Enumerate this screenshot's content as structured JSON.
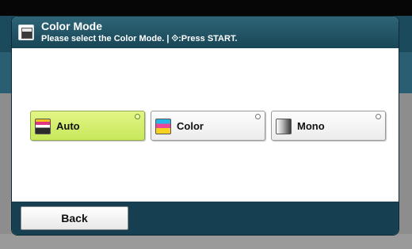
{
  "dialog": {
    "title": "Color Mode",
    "subtitle": "Please select the Color Mode. | ⟐:Press START.",
    "title_icon": "color-mode-icon"
  },
  "modes": [
    {
      "label": "Auto",
      "icon": "auto-color-icon",
      "selected": true
    },
    {
      "label": "Color",
      "icon": "color-icon",
      "selected": false
    },
    {
      "label": "Mono",
      "icon": "mono-icon",
      "selected": false
    }
  ],
  "footer": {
    "back_label": "Back"
  },
  "colors": {
    "title_bar": "#184656",
    "selected_button": "#c6e85a",
    "footer": "#164051"
  }
}
